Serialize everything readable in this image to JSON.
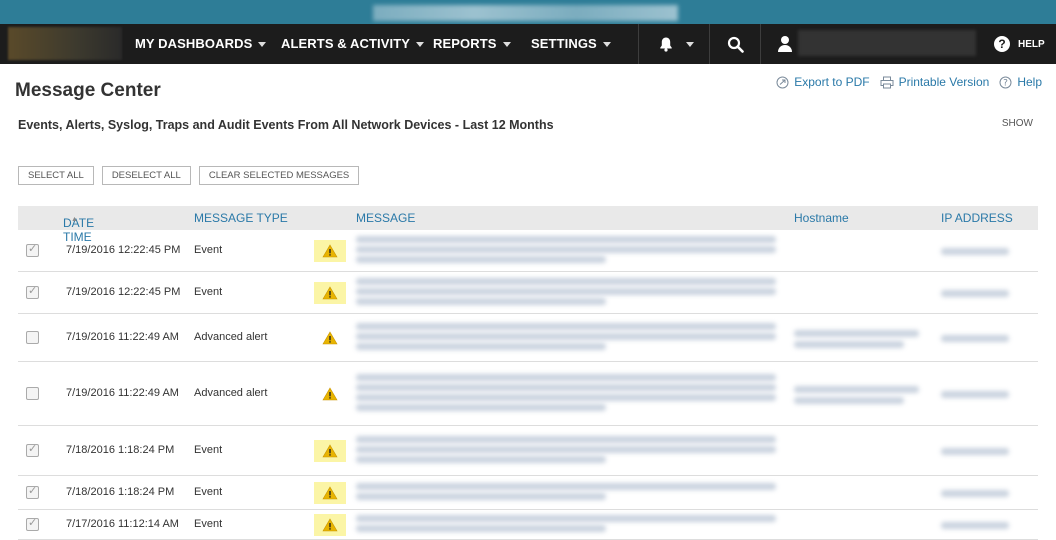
{
  "nav": {
    "items": [
      {
        "label": "MY DASHBOARDS"
      },
      {
        "label": "ALERTS & ACTIVITY"
      },
      {
        "label": "REPORTS"
      },
      {
        "label": "SETTINGS"
      }
    ],
    "help_label": "HELP"
  },
  "page": {
    "title": "Message Center",
    "subtitle": "Events, Alerts, Syslog, Traps and Audit Events From All Network Devices - Last 12 Months",
    "show_label": "SHOW",
    "links": {
      "export_pdf": "Export to PDF",
      "printable": "Printable Version",
      "help": "Help"
    }
  },
  "buttons": {
    "select_all": "SELECT ALL",
    "deselect_all": "DESELECT ALL",
    "clear_selected": "CLEAR SELECTED MESSAGES"
  },
  "table": {
    "columns": {
      "date_time": "DATE TIME",
      "message_type": "MESSAGE TYPE",
      "message": "MESSAGE",
      "hostname": "Hostname",
      "ip_address": "IP ADDRESS"
    },
    "rows": [
      {
        "datetime": "7/19/2016 12:22:45 PM",
        "type": "Event",
        "checked": true
      },
      {
        "datetime": "7/19/2016 12:22:45 PM",
        "type": "Event",
        "checked": true
      },
      {
        "datetime": "7/19/2016 11:22:49 AM",
        "type": "Advanced alert",
        "checked": false
      },
      {
        "datetime": "7/19/2016 11:22:49 AM",
        "type": "Advanced alert",
        "checked": false
      },
      {
        "datetime": "7/18/2016 1:18:24 PM",
        "type": "Event",
        "checked": true
      },
      {
        "datetime": "7/18/2016 1:18:24 PM",
        "type": "Event",
        "checked": true
      },
      {
        "datetime": "7/17/2016 11:12:14 AM",
        "type": "Event",
        "checked": true
      }
    ]
  },
  "colors": {
    "top_strip": "#2e7d97",
    "nav_bg": "#1c1c1c",
    "link": "#2a79a8",
    "warn_highlight": "#fbf5a6",
    "warn_icon": "#e8b400"
  }
}
